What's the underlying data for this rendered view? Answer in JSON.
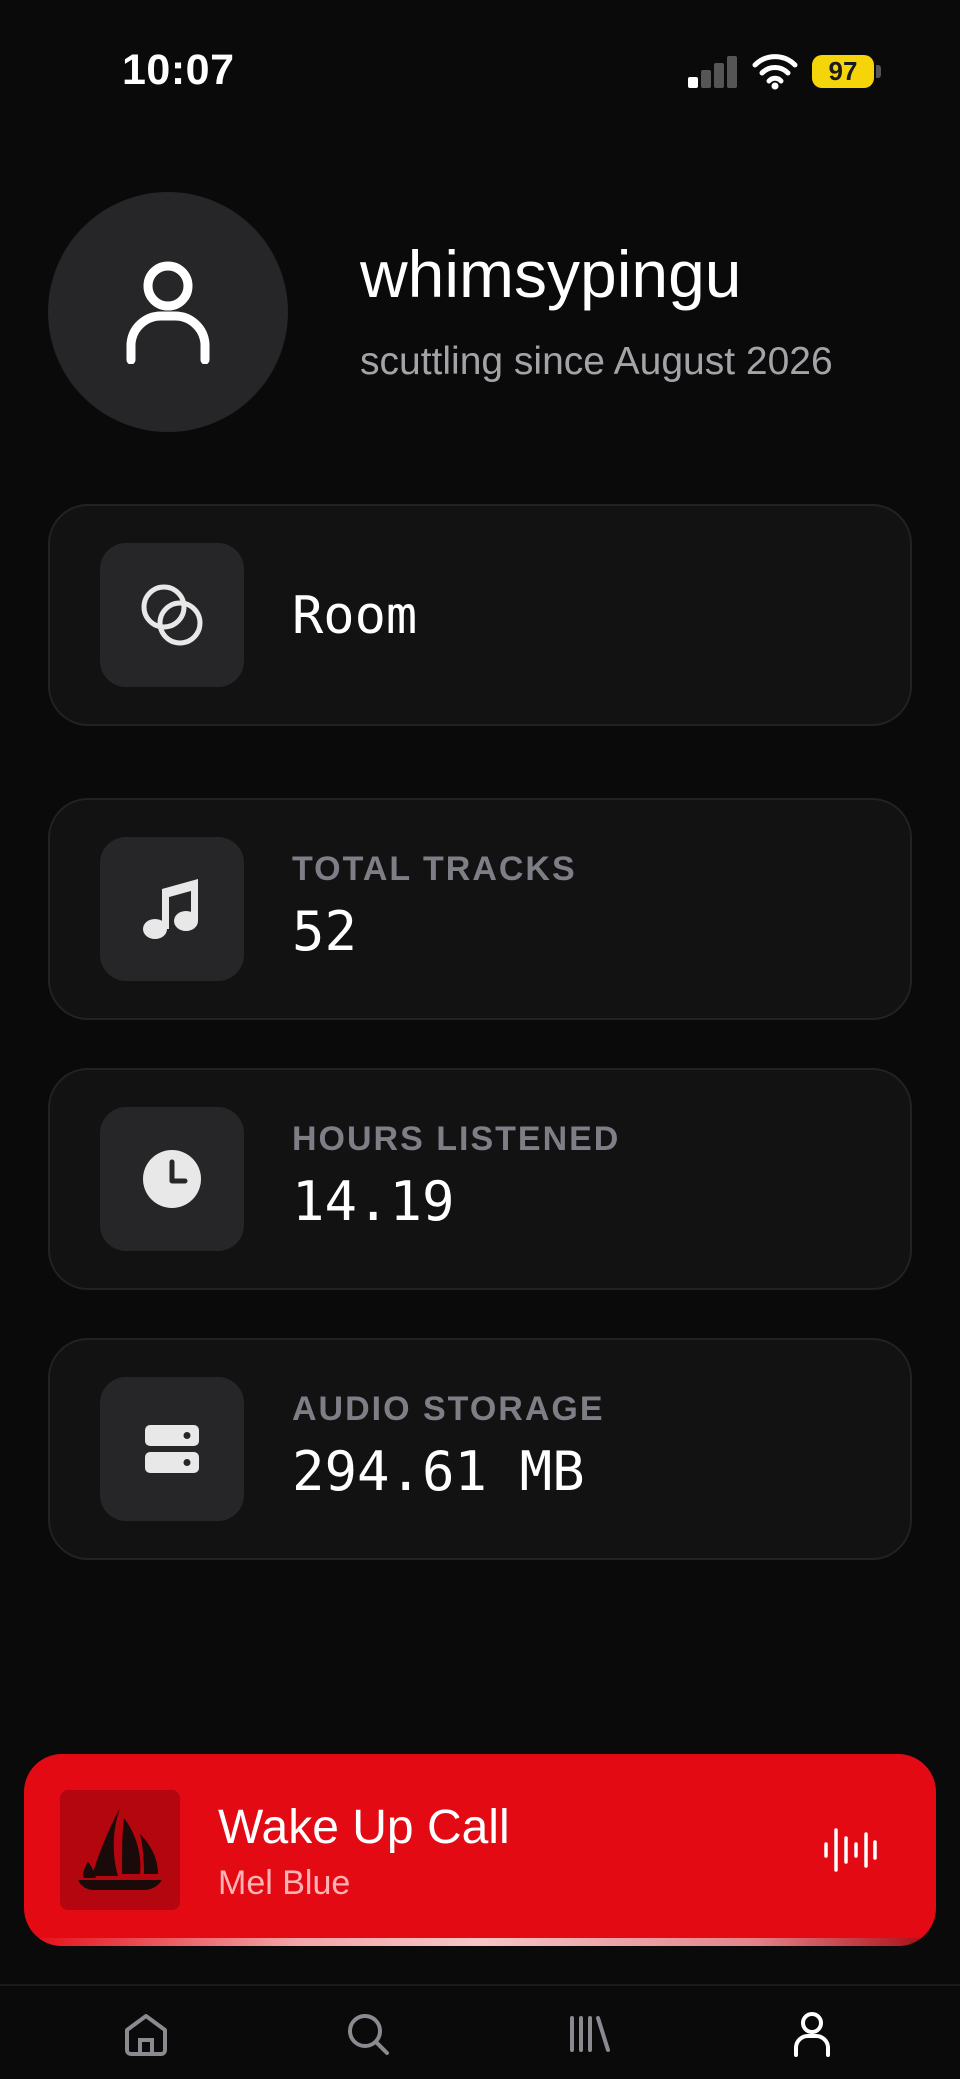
{
  "status_bar": {
    "time": "10:07",
    "battery": "97"
  },
  "profile": {
    "username": "whimsypingu",
    "since": "scuttling since August 2026"
  },
  "room": {
    "label": "Room",
    "icon": "two-circles-icon"
  },
  "stats": [
    {
      "label": "TOTAL TRACKS",
      "value": "52",
      "icon": "music-note-icon"
    },
    {
      "label": "HOURS LISTENED",
      "value": "14.19",
      "icon": "clock-icon"
    },
    {
      "label": "AUDIO STORAGE",
      "value": "294.61 MB",
      "icon": "storage-icon"
    }
  ],
  "now_playing": {
    "title": "Wake Up Call",
    "artist": "Mel Blue",
    "accent": "#e30a14"
  },
  "tab_bar": {
    "items": [
      {
        "name": "home",
        "icon": "home-icon"
      },
      {
        "name": "search",
        "icon": "search-icon"
      },
      {
        "name": "library",
        "icon": "library-icon"
      },
      {
        "name": "profile",
        "icon": "user-icon",
        "active": true
      }
    ]
  }
}
